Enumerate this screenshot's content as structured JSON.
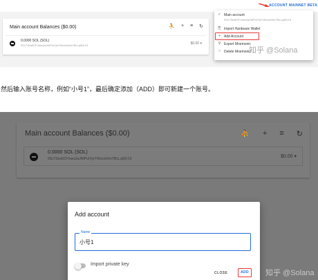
{
  "shot1": {
    "nav": {
      "account": "ACCOUNT",
      "network": "MAINNET BETA"
    },
    "card": {
      "title": "Main account Balances ($0.00)"
    },
    "token": {
      "balance": "0.0000 SOL (SOL)",
      "address": "9SxT3ea5CFmws2aJNfPuiYjeYWoxx6rhxYBLLq5Dr19",
      "usd": "$0.00 ▾"
    },
    "menu": {
      "current_label": "Main account",
      "current_address": "9SxT3ea5CFmws2aJNfPuiYjeYWoxx6rhxYBLLq5Dr19",
      "items": [
        "Import Hardware Wallet",
        "Add Account",
        "Export Mnemonic",
        "Delete Mnemonic"
      ]
    },
    "watermark": "知乎 @Solana"
  },
  "caption": "然后输入账号名称，例如“小号1”，最后确定添加（ADD）即可新建一个账号。",
  "shot2": {
    "card": {
      "title": "Main account Balances ($0.00)"
    },
    "token": {
      "balance": "0.0000 SOL (SOL)",
      "address": "9SxT3ea5CFmws2aJNfPuiYjeYWoxx6rhxYBLLq5Dr19",
      "usd": "$0.00 ▾"
    },
    "dialog": {
      "title": "Add account",
      "name_label": "Name",
      "name_value": "小号1",
      "toggle_label": "Import private key",
      "close_label": "CLOSE",
      "add_label": "ADD"
    },
    "watermark": "知乎 @Solana"
  },
  "icons": {
    "header": [
      "person-icon",
      "plus-icon",
      "sort-icon",
      "refresh-icon"
    ],
    "menu": [
      "check-icon",
      "import-icon",
      "plus-icon",
      "key-icon",
      "delete-icon"
    ]
  },
  "colors": {
    "accent": "#1e6bd6",
    "highlight": "#e53935",
    "overlay": "#7a7a7a"
  }
}
